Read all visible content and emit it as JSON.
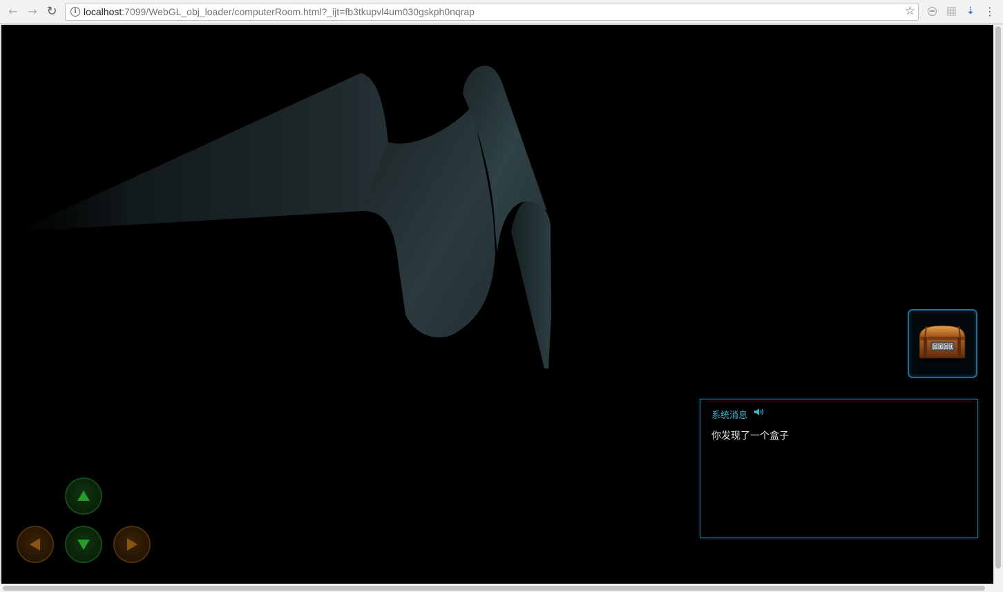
{
  "browser": {
    "url_host": "localhost",
    "url_rest": ":7099/WebGL_obj_loader/computerRoom.html?_ijt=fb3tkupvl4um030gskph0nqrap",
    "back_icon": "back-arrow-icon",
    "forward_icon": "forward-arrow-icon",
    "reload_icon": "reload-icon",
    "bookmark_icon": "star-icon"
  },
  "game": {
    "inventory": {
      "item_icon": "treasure-chest-icon"
    },
    "message_panel": {
      "title": "系统消息",
      "title_icon": "speaker-icon",
      "message": "你发现了一个盒子"
    },
    "controls": {
      "up_icon": "arrow-up-icon",
      "down_icon": "arrow-down-icon",
      "left_icon": "arrow-left-icon",
      "right_icon": "arrow-right-icon"
    }
  },
  "colors": {
    "viewport_background": "#000000",
    "panel_border": "#1c7fa6",
    "panel_title": "#3ab4d0",
    "dpad_green": "#2a9a2a",
    "dpad_orange": "#8a560f",
    "scene_surface": "#2d3f44"
  }
}
